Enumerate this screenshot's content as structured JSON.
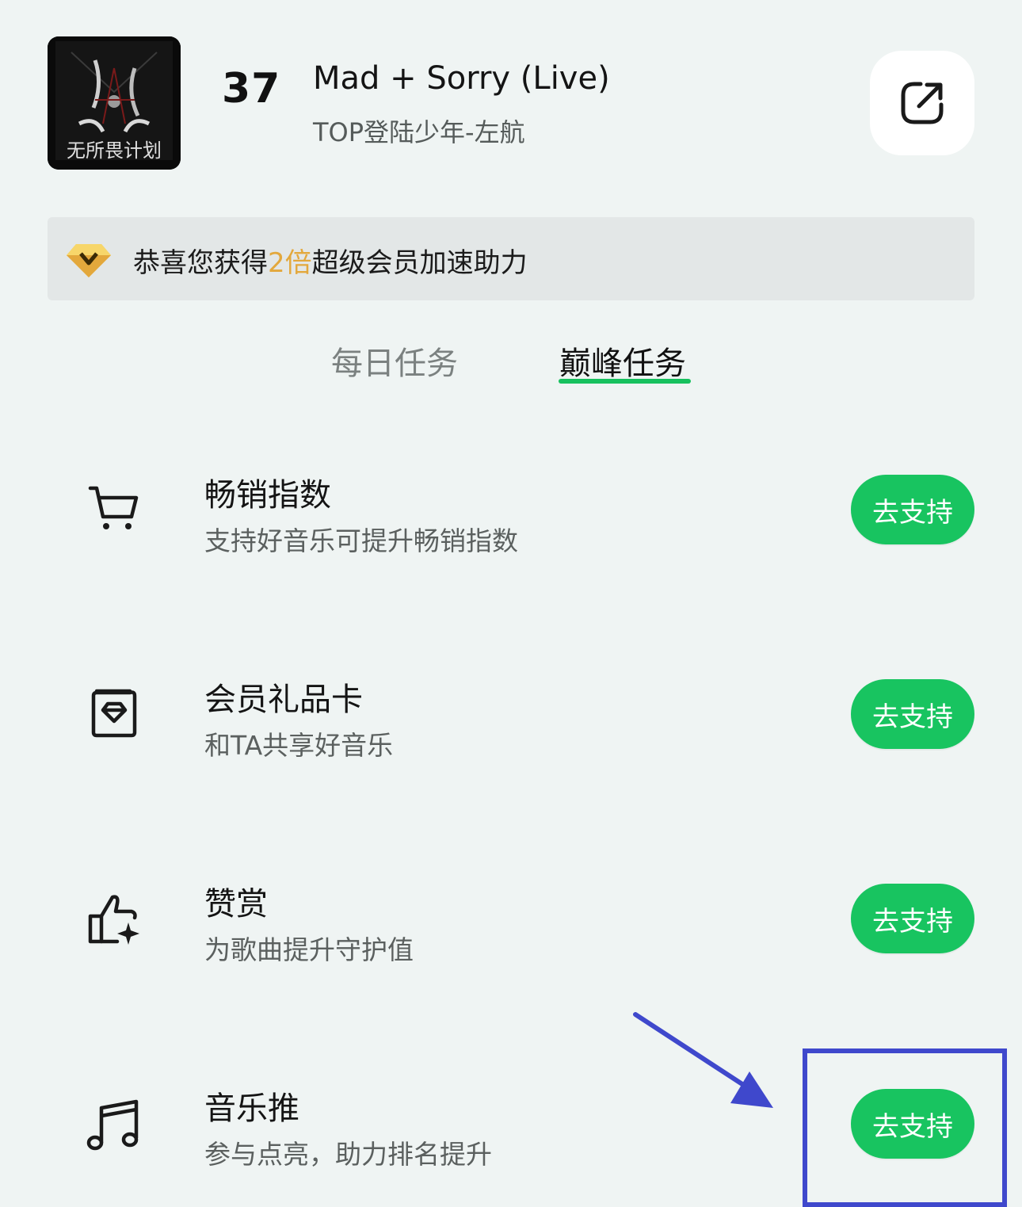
{
  "header": {
    "cover_text": "无所畏计划",
    "rank": "37",
    "title": "Mad + Sorry (Live)",
    "subtitle": "TOP登陆少年-左航",
    "share_icon": "share-icon"
  },
  "banner": {
    "icon": "diamond-icon",
    "prefix": "恭喜您获得",
    "highlight": "2倍",
    "suffix": "超级会员加速助力",
    "highlight_color": "#e3a83c"
  },
  "tabs": [
    {
      "label": "每日任务",
      "active": false
    },
    {
      "label": "巅峰任务",
      "active": true
    }
  ],
  "tasks": [
    {
      "icon": "cart-icon",
      "title": "畅销指数",
      "desc": "支持好音乐可提升畅销指数",
      "button": "去支持"
    },
    {
      "icon": "gift-card-icon",
      "title": "会员礼品卡",
      "desc": "和TA共享好音乐",
      "button": "去支持"
    },
    {
      "icon": "thumbs-up-icon",
      "title": "赞赏",
      "desc": "为歌曲提升守护值",
      "button": "去支持"
    },
    {
      "icon": "music-note-icon",
      "title": "音乐推",
      "desc": "参与点亮，助力排名提升",
      "button": "去支持"
    }
  ],
  "colors": {
    "accent": "#18c460",
    "annotation": "#3f48cc",
    "background": "#eff4f3"
  }
}
